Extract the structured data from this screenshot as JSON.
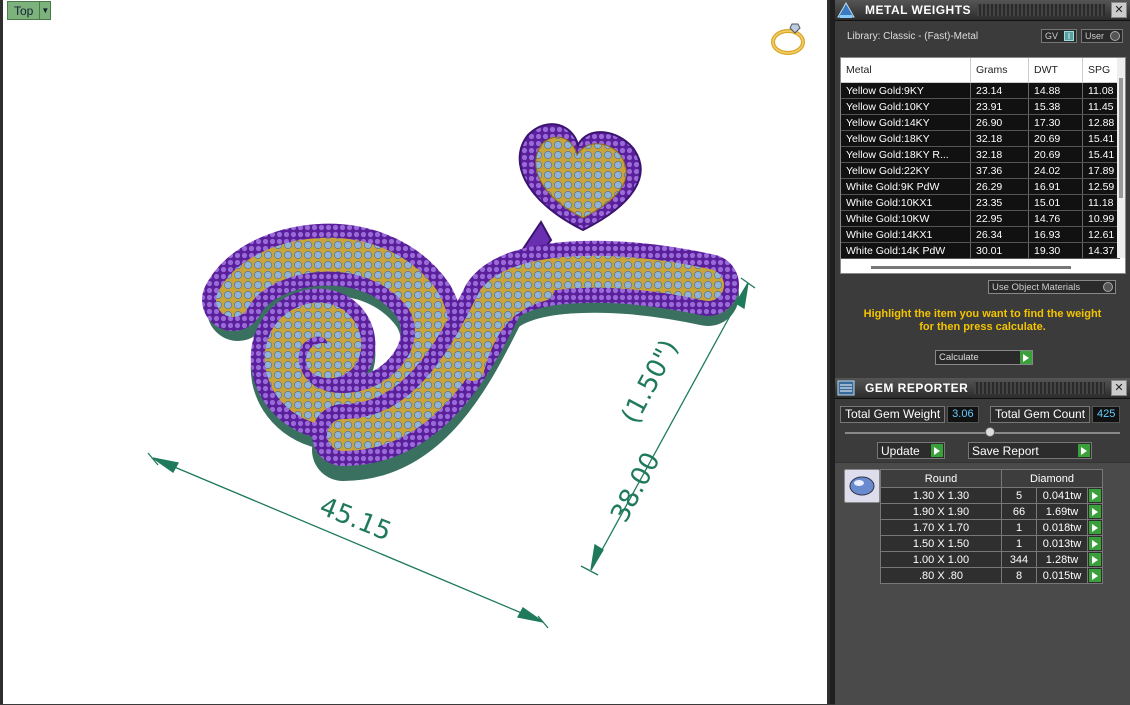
{
  "viewport": {
    "view_label": "Top",
    "dim_width": "45.15",
    "dim_height": "38.00",
    "dim_height_in": "(1.50\")"
  },
  "metal_weights": {
    "title": "METAL WEIGHTS",
    "library": "Library: Classic - (Fast)-Metal",
    "gv_label": "GV",
    "user_label": "User",
    "columns": [
      "Metal",
      "Grams",
      "DWT",
      "SPG"
    ],
    "rows": [
      [
        "Yellow Gold:9KY",
        "23.14",
        "14.88",
        "11.08"
      ],
      [
        "Yellow Gold:10KY",
        "23.91",
        "15.38",
        "11.45"
      ],
      [
        "Yellow Gold:14KY",
        "26.90",
        "17.30",
        "12.88"
      ],
      [
        "Yellow Gold:18KY",
        "32.18",
        "20.69",
        "15.41"
      ],
      [
        "Yellow Gold:18KY R...",
        "32.18",
        "20.69",
        "15.41"
      ],
      [
        "Yellow Gold:22KY",
        "37.36",
        "24.02",
        "17.89"
      ],
      [
        "White Gold:9K PdW",
        "26.29",
        "16.91",
        "12.59"
      ],
      [
        "White Gold:10KX1",
        "23.35",
        "15.01",
        "11.18"
      ],
      [
        "White Gold:10KW",
        "22.95",
        "14.76",
        "10.99"
      ],
      [
        "White Gold:14KX1",
        "26.34",
        "16.93",
        "12.61"
      ],
      [
        "White Gold:14K PdW",
        "30.01",
        "19.30",
        "14.37"
      ]
    ],
    "use_object_materials": "Use Object Materials",
    "hint_line1": "Highlight the item you want to find the weight",
    "hint_line2": "for then press calculate.",
    "calculate_label": "Calculate"
  },
  "gem_reporter": {
    "title": "GEM REPORTER",
    "total_weight_label": "Total Gem Weight",
    "total_weight_value": "3.06",
    "total_count_label": "Total Gem Count",
    "total_count_value": "425",
    "update_label": "Update",
    "save_report_label": "Save Report",
    "shape": "Round",
    "material": "Diamond",
    "rows": [
      [
        "1.30 X 1.30",
        "5",
        "0.041tw"
      ],
      [
        "1.90 X 1.90",
        "66",
        "1.69tw"
      ],
      [
        "1.70 X 1.70",
        "1",
        "0.018tw"
      ],
      [
        "1.50 X 1.50",
        "1",
        "0.013tw"
      ],
      [
        "1.00 X 1.00",
        "344",
        "1.28tw"
      ],
      [
        ".80 X .80",
        "8",
        "0.015tw"
      ]
    ]
  },
  "colors": {
    "metal_purple": "#6a2fb0",
    "gold": "#c9a43a",
    "stone_blue": "#8fb4d8",
    "dimension_green": "#1e7a5a",
    "hint_yellow": "#f4c400"
  }
}
